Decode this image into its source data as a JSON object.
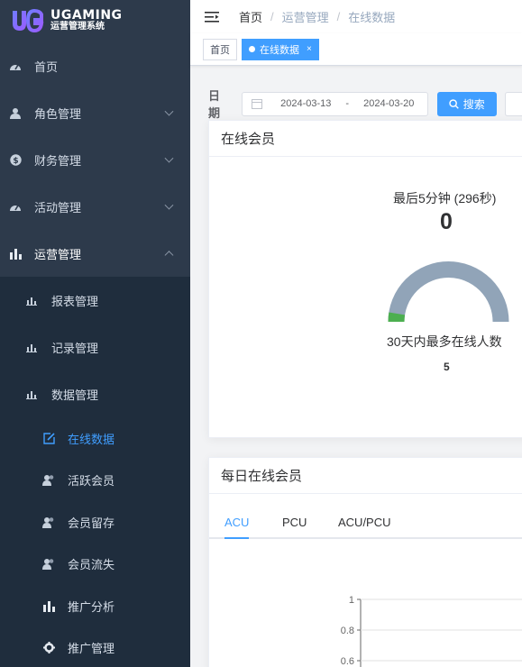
{
  "brand": {
    "title": "UGAMING",
    "subtitle": "运营管理系统",
    "accent": "#409eff"
  },
  "sidebar": {
    "items": [
      {
        "label": "首页",
        "icon": "dashboard-icon"
      },
      {
        "label": "角色管理",
        "icon": "user-icon"
      },
      {
        "label": "财务管理",
        "icon": "dollar-icon"
      },
      {
        "label": "活动管理",
        "icon": "dashboard-icon"
      },
      {
        "label": "运营管理",
        "icon": "bar-chart-icon"
      }
    ],
    "sub_items": [
      {
        "label": "报表管理",
        "icon": "bar-chart-icon"
      },
      {
        "label": "记录管理",
        "icon": "bar-chart-icon"
      },
      {
        "label": "数据管理",
        "icon": "bar-chart-icon"
      }
    ],
    "leaves": [
      {
        "label": "在线数据",
        "icon": "edit-icon"
      },
      {
        "label": "活跃会员",
        "icon": "users-icon"
      },
      {
        "label": "会员留存",
        "icon": "users-icon"
      },
      {
        "label": "会员流失",
        "icon": "users-icon"
      },
      {
        "label": "推广分析",
        "icon": "bar-chart-icon"
      },
      {
        "label": "推广管理",
        "icon": "gear-icon"
      }
    ]
  },
  "breadcrumb": {
    "home": "首页",
    "level1": "运营管理",
    "current": "在线数据",
    "separator": "/"
  },
  "tags": {
    "home": "首页",
    "active": "在线数据",
    "close": "×"
  },
  "filter": {
    "label": "日期",
    "start": "2024-03-13",
    "separator": "-",
    "end": "2024-03-20",
    "search_label": "搜索"
  },
  "online_card": {
    "title": "在线会员",
    "last5_label": "最后5分钟 (296秒)",
    "last5_value": "0",
    "peak_label": "30天内最多在线人数",
    "peak_value": "5",
    "gauge_fraction": 0.05,
    "gauge_colors": {
      "track": "#91a4b8",
      "fill": "#4caf50"
    }
  },
  "daily_card": {
    "title": "每日在线会员",
    "tabs": [
      "ACU",
      "PCU",
      "ACU/PCU"
    ],
    "active_tab": "ACU"
  },
  "chart_data": {
    "type": "line",
    "title": "",
    "xlabel": "",
    "ylabel": "",
    "yticks": [
      "1",
      "0.8",
      "0.6"
    ],
    "ylim": [
      0.6,
      1
    ],
    "grid": true,
    "series": []
  }
}
